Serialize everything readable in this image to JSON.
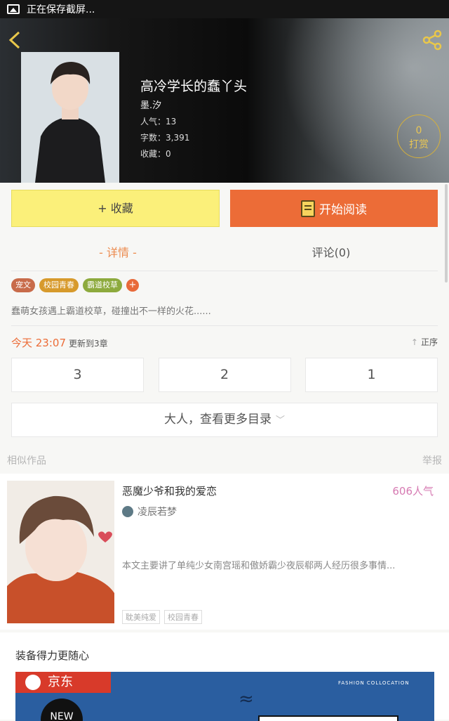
{
  "status_bar": {
    "text": "正在保存截屏..."
  },
  "book": {
    "title": "高冷学长的蠢丫头",
    "author": "墨.汐",
    "popularity": "人气：13",
    "word_count": "字数：3,391",
    "favorites": "收藏：0",
    "tip_count": "0",
    "tip_label": "打赏"
  },
  "actions": {
    "favorite_label": "+ 收藏",
    "read_label": "开始阅读"
  },
  "tabs": {
    "detail": "- 详情 -",
    "comments": "评论(0)"
  },
  "tags": [
    {
      "label": "宠文",
      "color": "#c86b4a"
    },
    {
      "label": "校园青春",
      "color": "#d79a2c"
    },
    {
      "label": "霸道校草",
      "color": "#8daa3d"
    }
  ],
  "tag_add": "+",
  "description": "蠢萌女孩遇上霸道校草，碰撞出不一样的火花......",
  "update": {
    "time": "今天 23:07",
    "text": "更新到3章",
    "order": "正序"
  },
  "chapters": [
    "3",
    "2",
    "1"
  ],
  "more_toc": "大人，查看更多目录",
  "similar": {
    "heading": "相似作品",
    "report": "举报",
    "item": {
      "title": "恶魔少爷和我的爱恋",
      "popularity": "606人气",
      "author": "凌辰若梦",
      "desc": "本文主要讲了单纯少女南宫瑶和傲娇霸少夜辰郗两人经历很多事情...",
      "tags": [
        "耽美纯爱",
        "校园青春"
      ]
    }
  },
  "ad": {
    "title": "装备得力更随心",
    "brand": "京东",
    "tagline": "FASHION COLLOCATION",
    "badge": "NEW"
  }
}
